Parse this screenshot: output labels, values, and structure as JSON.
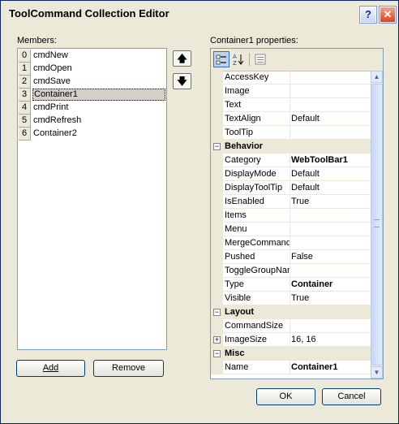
{
  "window": {
    "title": "ToolCommand Collection Editor",
    "help_label": "?",
    "close_label": "✕"
  },
  "members": {
    "label": "Members:",
    "items": [
      {
        "index": "0",
        "name": "cmdNew"
      },
      {
        "index": "1",
        "name": "cmdOpen"
      },
      {
        "index": "2",
        "name": "cmdSave"
      },
      {
        "index": "3",
        "name": "Container1",
        "selected": true
      },
      {
        "index": "4",
        "name": "cmdPrint"
      },
      {
        "index": "5",
        "name": "cmdRefresh"
      },
      {
        "index": "6",
        "name": "Container2"
      }
    ],
    "add_label": "Add",
    "remove_label": "Remove"
  },
  "properties": {
    "label": "Container1 properties:",
    "rows": [
      {
        "kind": "prop",
        "name": "AccessKey",
        "value": ""
      },
      {
        "kind": "prop",
        "name": "Image",
        "value": ""
      },
      {
        "kind": "prop",
        "name": "Text",
        "value": ""
      },
      {
        "kind": "prop",
        "name": "TextAlign",
        "value": "Default"
      },
      {
        "kind": "prop",
        "name": "ToolTip",
        "value": ""
      },
      {
        "kind": "cat",
        "name": "Behavior",
        "expander": "−"
      },
      {
        "kind": "prop",
        "name": "Category",
        "value": "WebToolBar1",
        "bold": true
      },
      {
        "kind": "prop",
        "name": "DisplayMode",
        "value": "Default"
      },
      {
        "kind": "prop",
        "name": "DisplayToolTip",
        "value": "Default"
      },
      {
        "kind": "prop",
        "name": "IsEnabled",
        "value": "True"
      },
      {
        "kind": "prop",
        "name": "Items",
        "value": ""
      },
      {
        "kind": "prop",
        "name": "Menu",
        "value": ""
      },
      {
        "kind": "prop",
        "name": "MergeCommandI",
        "value": ""
      },
      {
        "kind": "prop",
        "name": "Pushed",
        "value": "False"
      },
      {
        "kind": "prop",
        "name": "ToggleGroupNan",
        "value": ""
      },
      {
        "kind": "prop",
        "name": "Type",
        "value": "Container",
        "bold": true
      },
      {
        "kind": "prop",
        "name": "Visible",
        "value": "True"
      },
      {
        "kind": "cat",
        "name": "Layout",
        "expander": "−"
      },
      {
        "kind": "prop",
        "name": "CommandSize",
        "value": ""
      },
      {
        "kind": "prop",
        "name": "ImageSize",
        "value": "16, 16",
        "expander": "+"
      },
      {
        "kind": "cat",
        "name": "Misc",
        "expander": "−"
      },
      {
        "kind": "prop",
        "name": "Name",
        "value": "Container1",
        "bold": true
      }
    ]
  },
  "buttons": {
    "ok_label": "OK",
    "cancel_label": "Cancel"
  }
}
